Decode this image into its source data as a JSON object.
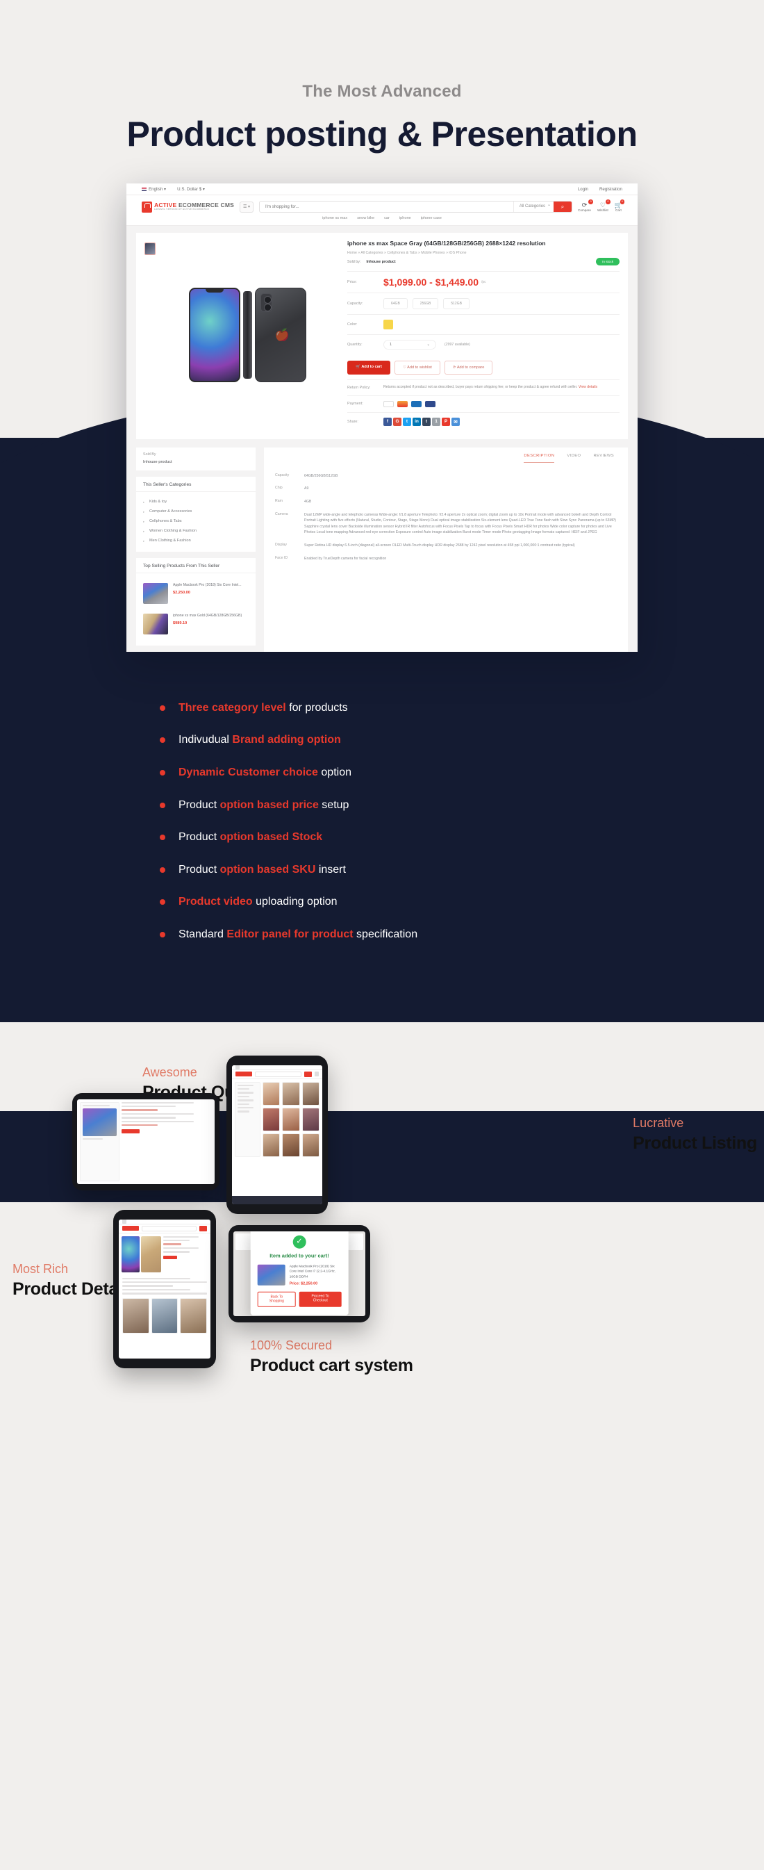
{
  "hero": {
    "kicker": "The Most Advanced",
    "title": "Product posting & Presentation"
  },
  "browser": {
    "topbar": {
      "language": "English",
      "currency": "U.S. Dollar $",
      "login": "Login",
      "registration": "Registration"
    },
    "logo": {
      "main_active": "ACTIVE",
      "main_rest": "ECOMMERCE CMS",
      "tagline": "LARAVEL VERSION OF ACTIVE ECOMMERCE"
    },
    "search": {
      "placeholder": "I'm shopping for...",
      "category": "All Categories",
      "button": "search-icon"
    },
    "header_icons": [
      {
        "label": "Compare",
        "count": "0",
        "icon": "compare-icon"
      },
      {
        "label": "Wishlist",
        "count": "0",
        "icon": "heart-icon"
      },
      {
        "label": "Cart",
        "count": "0",
        "icon": "cart-icon"
      }
    ],
    "keywords": [
      "iphone xs max",
      "snow bike",
      "car",
      "iphone",
      "iphone case"
    ],
    "product": {
      "title": "iphone xs max Space Gray (64GB/128GB/256GB) 2688×1242 resolution",
      "breadcrumb": "Home » All Categories » Cellphones & Tabs » Mobile Phones » iOS Phone",
      "sold_by_label": "Sold by:",
      "sold_by_value": "Inhouse product",
      "stock_badge": "In stock",
      "price_label": "Price:",
      "price_value": "$1,099.00 - $1,449.00",
      "price_unit": "/pc",
      "capacity_label": "Capacity:",
      "capacity_options": [
        "64GB",
        "256GB",
        "512GB"
      ],
      "color_label": "Color:",
      "color_swatch": "#f7d64a",
      "quantity_label": "Quantity:",
      "quantity_value": "1",
      "quantity_available": "(2997 available)",
      "buttons": {
        "add_to_cart": "Add to cart",
        "add_to_wishlist": "Add to wishlist",
        "add_to_compare": "Add to compare"
      },
      "return_policy_label": "Return Policy:",
      "return_policy_text": "Returns accepted if product not as described, buyer pays return shipping fee; or keep the product & agree refund with seller.",
      "return_policy_link": "View details",
      "payment_label": "Payment:",
      "share_label": "Share:"
    },
    "sidebar": {
      "sold_by_title": "Sold By",
      "sold_by_value": "Inhouse product",
      "categories_title": "This Seller's Categories",
      "categories": [
        "Kids & toy",
        "Computer & Accessories",
        "Cellphones & Tabs",
        "Women Clothing & Fashion",
        "Men Clothing & Fashion"
      ],
      "top_selling_title": "Top Selling Products From This Seller",
      "top_selling": [
        {
          "name": "Apple Macbook Pro (2018) Six Core Intel...",
          "price": "$2,250.00"
        },
        {
          "name": "iphone xs max Gold (64GB/128GB/256GB)",
          "price": "$989.10"
        }
      ]
    },
    "tabs": [
      {
        "label": "DESCRIPTION",
        "active": true
      },
      {
        "label": "VIDEO",
        "active": false
      },
      {
        "label": "REVIEWS",
        "active": false
      }
    ],
    "specs": [
      {
        "key": "Capacity",
        "value": "64GB/256GB/512GB"
      },
      {
        "key": "Chip",
        "value": "A9"
      },
      {
        "key": "Ram",
        "value": "4GB"
      },
      {
        "key": "Camera",
        "value": "Dual 12MP wide-angle and telephoto cameras Wide-angle: f/1.8 aperture Telephoto: f/2.4 aperture 2x optical zoom; digital zoom up to 10x Portrait mode with advanced bokeh and Depth Control Portrait Lighting with five effects (Natural, Studio, Contour, Stage, Stage Mono) Dual optical image stabilization Six-element lens Quad-LED True Tone flash with Slow Sync Panorama (up to 63MP) Sapphire crystal lens cover Backside illumination sensor Hybrid IR filter Autofocus with Focus Pixels Tap to focus with Focus Pixels Smart HDR for photos Wide color capture for photos and Live Photos Local tone mapping Advanced red-eye correction Exposure control Auto image stabilization Burst mode Timer mode Photo geotagging Image formats captured: HEIF and JPEG"
      },
      {
        "key": "Display",
        "value": "Super Retina HD display 6.5-inch (diagonal) all-screen OLED Multi-Touch display HDR display 2688 by 1242 pixel resolution at 458 ppi 1,000,000:1 contrast ratio (typical)"
      },
      {
        "key": "Face ID",
        "value": "Enabled by TrueDepth camera for facial recognition"
      }
    ]
  },
  "features": [
    {
      "parts": [
        {
          "t": "Three  category level",
          "em": true
        },
        {
          "t": " for products",
          "em": false
        }
      ]
    },
    {
      "parts": [
        {
          "t": "Indivudual ",
          "em": false
        },
        {
          "t": "Brand adding option",
          "em": true
        }
      ]
    },
    {
      "parts": [
        {
          "t": "Dynamic Customer choice",
          "em": true
        },
        {
          "t": " option",
          "em": false
        }
      ]
    },
    {
      "parts": [
        {
          "t": "Product ",
          "em": false
        },
        {
          "t": "option based price",
          "em": true
        },
        {
          "t": " setup",
          "em": false
        }
      ]
    },
    {
      "parts": [
        {
          "t": "Product ",
          "em": false
        },
        {
          "t": "option based Stock",
          "em": true
        }
      ]
    },
    {
      "parts": [
        {
          "t": "Product ",
          "em": false
        },
        {
          "t": "option based SKU",
          "em": true
        },
        {
          "t": " insert",
          "em": false
        }
      ]
    },
    {
      "parts": [
        {
          "t": "Product video",
          "em": true
        },
        {
          "t": " uploading option",
          "em": false
        }
      ]
    },
    {
      "parts": [
        {
          "t": "Standard ",
          "em": false
        },
        {
          "t": "Editor panel for product",
          "em": true
        },
        {
          "t": " specification",
          "em": false
        }
      ]
    }
  ],
  "showcase": {
    "quick_view": {
      "kicker": "Awesome",
      "title": "Product Quick View"
    },
    "listing": {
      "kicker": "Lucrative",
      "title": "Product Listing"
    },
    "detail": {
      "kicker": "Most Rich",
      "title": "Product Detail"
    },
    "cart": {
      "kicker": "100% Secured",
      "title": "Product cart system"
    }
  },
  "cart_modal": {
    "heading": "Item added to your cart!",
    "product_name": "Apple Macbook Pro (2018) Six Core Intel Core i7 (2.2-4.1GHz, 16GB DDR4",
    "price_label": "Price:",
    "price_value": "$2,250.00",
    "back_button": "Back To Shopping",
    "checkout_button": "Proceed To Checkout"
  },
  "colors": {
    "accent": "#e8392c",
    "dark": "#141b32",
    "page_bg": "#f1efed",
    "green": "#2fbf5c"
  }
}
